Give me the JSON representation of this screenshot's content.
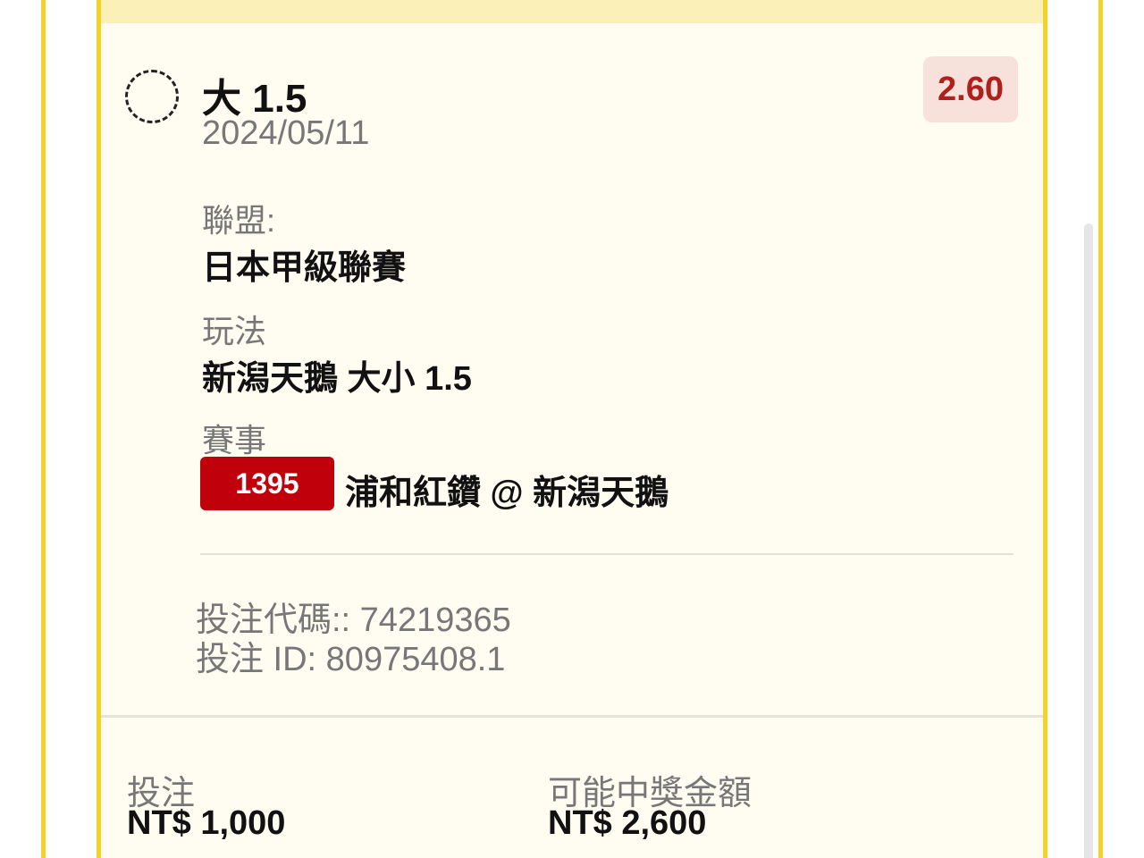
{
  "bet": {
    "selection": "大 1.5",
    "date": "2024/05/11",
    "odds": "2.60",
    "league_label": "聯盟:",
    "league_value": "日本甲級聯賽",
    "market_label": "玩法",
    "market_value": "新潟天鵝 大小 1.5",
    "event_label": "賽事",
    "event_code": "1395",
    "event_name": "浦和紅鑽 @ 新潟天鵝",
    "bet_code": "投注代碼:: 74219365",
    "bet_id": "投注 ID: 80975408.1"
  },
  "footer": {
    "stake_label": "投注",
    "stake_value": "NT$ 1,000",
    "payout_label": "可能中獎金額",
    "payout_value": "NT$ 2,600"
  },
  "icons": {
    "status": "pending-dashed-circle-icon"
  },
  "colors": {
    "frame": "#f5d228",
    "card_bg": "#fffdf2",
    "odds_text": "#b0201c",
    "odds_bg": "#f7e1da",
    "badge_bg": "#c0000a"
  }
}
